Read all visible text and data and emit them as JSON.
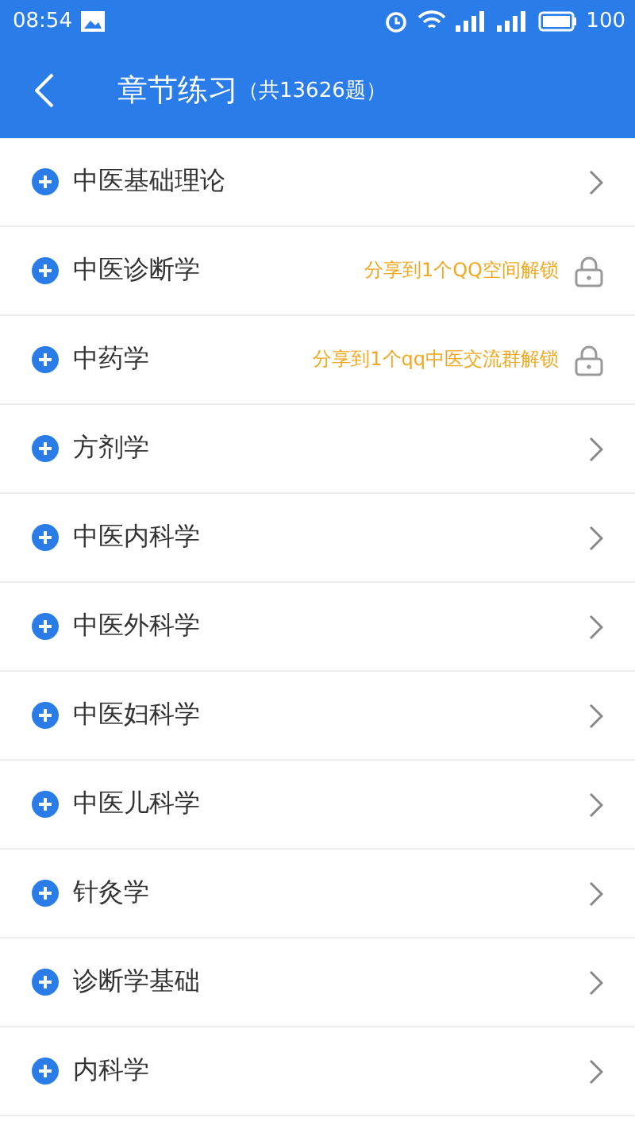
{
  "status_bar": {
    "time": "08:54",
    "battery": "100"
  },
  "header": {
    "title": "章节练习",
    "subtitle": "（共13626题）"
  },
  "chapters": [
    {
      "title": "中医基础理论",
      "kind": "open"
    },
    {
      "title": "中医诊断学",
      "kind": "locked",
      "hint": "分享到1个QQ空间解锁"
    },
    {
      "title": "中药学",
      "kind": "locked",
      "hint": "分享到1个qq中医交流群解锁"
    },
    {
      "title": "方剂学",
      "kind": "open"
    },
    {
      "title": "中医内科学",
      "kind": "open"
    },
    {
      "title": "中医外科学",
      "kind": "open"
    },
    {
      "title": "中医妇科学",
      "kind": "open"
    },
    {
      "title": "中医儿科学",
      "kind": "open"
    },
    {
      "title": "针灸学",
      "kind": "open"
    },
    {
      "title": "诊断学基础",
      "kind": "open"
    },
    {
      "title": "内科学",
      "kind": "open"
    }
  ]
}
